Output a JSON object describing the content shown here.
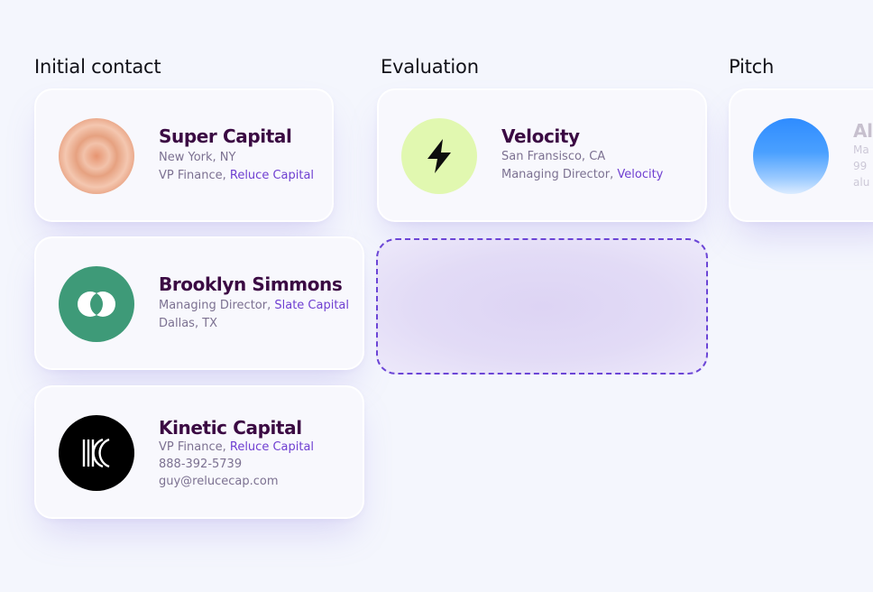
{
  "columns": [
    {
      "title": "Initial contact",
      "cards": [
        {
          "name": "Super Capital",
          "line1": "New York, NY",
          "line2_prefix": "VP Finance, ",
          "line2_link": "Reluce Capital"
        },
        {
          "name": "Brooklyn Simmons",
          "line1_prefix": "Managing Director, ",
          "line1_link": "Slate Capital",
          "line2": "Dallas, TX"
        },
        {
          "name": "Kinetic Capital",
          "line1_prefix": "VP Finance, ",
          "line1_link": "Reluce Capital",
          "line2": "888-392-5739",
          "line3": "guy@relucecap.com"
        }
      ]
    },
    {
      "title": "Evaluation",
      "cards": [
        {
          "name": "Velocity",
          "line1": "San Fransisco, CA",
          "line2_prefix": "Managing Director, ",
          "line2_link": "Velocity"
        }
      ]
    },
    {
      "title": "Pitch",
      "cards": [
        {
          "name": "Al",
          "line1": "Ma",
          "line2": "99",
          "line3": "alu"
        }
      ]
    }
  ],
  "colors": {
    "background": "#f4f6fd",
    "name": "#3b0a43",
    "accent": "#6f3fd1",
    "muted": "#7c7191",
    "brooklyn_logo": "#3e9a78",
    "velocity_logo": "#e1f8b0",
    "kinetic_logo": "#000000"
  },
  "icons": [
    "super-capital-logo-icon",
    "brooklyn-logo-icon",
    "kinetic-logo-icon",
    "lightning-bolt-icon",
    "pitch-logo-icon"
  ]
}
